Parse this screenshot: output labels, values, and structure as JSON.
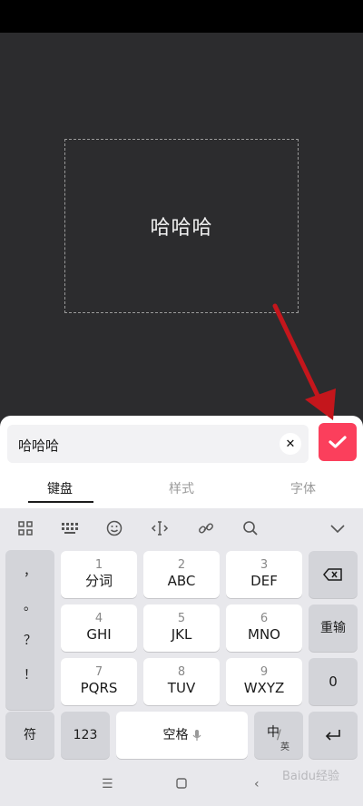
{
  "editor": {
    "preview_text": "哈哈哈"
  },
  "text_input": {
    "value": "哈哈哈"
  },
  "tabs": [
    {
      "label": "键盘"
    },
    {
      "label": "样式"
    },
    {
      "label": "字体"
    }
  ],
  "keyboard": {
    "symbols": [
      "，",
      "。",
      "？",
      "！"
    ],
    "keys": [
      {
        "num": "1",
        "letters": "分词"
      },
      {
        "num": "2",
        "letters": "ABC"
      },
      {
        "num": "3",
        "letters": "DEF"
      },
      {
        "num": "4",
        "letters": "GHI"
      },
      {
        "num": "5",
        "letters": "JKL"
      },
      {
        "num": "6",
        "letters": "MNO"
      },
      {
        "num": "7",
        "letters": "PQRS"
      },
      {
        "num": "8",
        "letters": "TUV"
      },
      {
        "num": "9",
        "letters": "WXYZ"
      }
    ],
    "reinput_label": "重输",
    "zero_label": "0",
    "symbol_label": "符",
    "numeric_label": "123",
    "space_label": "空格",
    "lang_main": "中",
    "lang_sub": "英"
  },
  "watermark": "Baidu经验",
  "colors": {
    "accent": "#fb3f5c",
    "arrow": "#c4161c"
  }
}
